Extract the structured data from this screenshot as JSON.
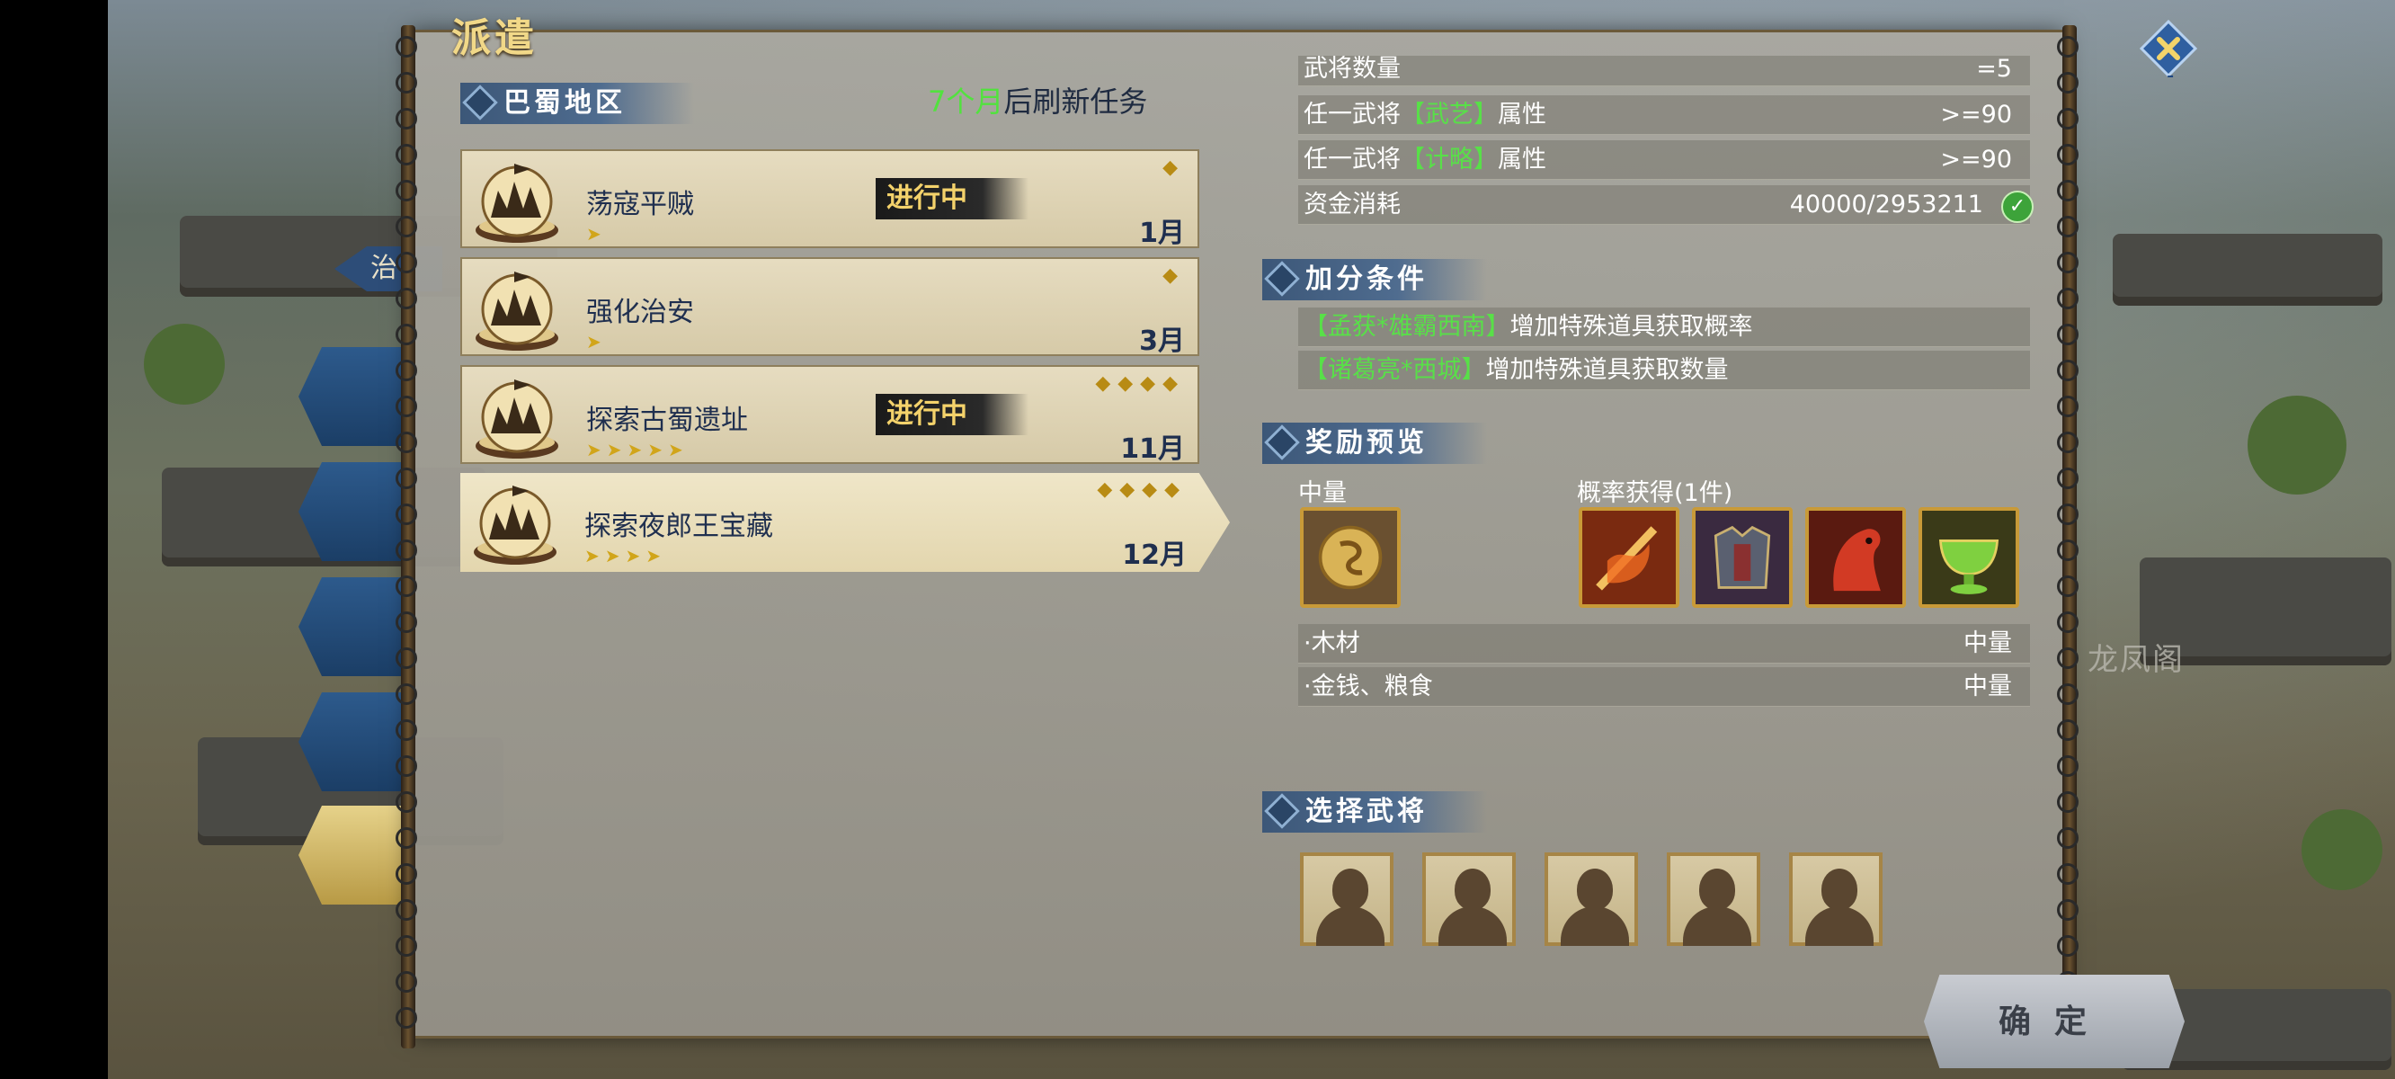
{
  "panel": {
    "title": "派遣"
  },
  "region": {
    "name": "巴蜀地区",
    "refresh_highlight": "7个月",
    "refresh_rest": "后刷新任务"
  },
  "missions": [
    {
      "name": "荡寇平贼",
      "month": "1月",
      "status": "进行中",
      "stars": 1,
      "difficulty": 1
    },
    {
      "name": "强化治安",
      "month": "3月",
      "status": "",
      "stars": 1,
      "difficulty": 1
    },
    {
      "name": "探索古蜀遗址",
      "month": "11月",
      "status": "进行中",
      "stars": 5,
      "difficulty": 4
    },
    {
      "name": "探索夜郎王宝藏",
      "month": "12月",
      "status": "",
      "stars": 4,
      "difficulty": 4
    }
  ],
  "requirements": {
    "row0": {
      "label": "武将数量",
      "value": "=5"
    },
    "row1": {
      "prefix": "任一武将",
      "highlight": "【武艺】",
      "suffix": "属性",
      "value": ">=90"
    },
    "row2": {
      "prefix": "任一武将",
      "highlight": "【计略】",
      "suffix": "属性",
      "value": ">=90"
    },
    "row3": {
      "label": "资金消耗",
      "value": "40000/2953211"
    }
  },
  "bonus": {
    "header": "加分条件",
    "items": [
      {
        "highlight": "【孟获*雄霸西南】",
        "text": "增加特殊道具获取概率"
      },
      {
        "highlight": "【诸葛亮*西城】",
        "text": "增加特殊道具获取数量"
      }
    ]
  },
  "rewards": {
    "header": "奖励预览",
    "fixed_label": "中量",
    "chance_label": "概率获得(1件)",
    "lines": [
      {
        "label": "·木材",
        "value": "中量"
      },
      {
        "label": "·金钱、粮食",
        "value": "中量"
      }
    ],
    "icons": [
      "coin-medal-icon",
      "flame-sword-icon",
      "armor-icon",
      "red-horse-icon",
      "jade-cup-icon"
    ]
  },
  "generals": {
    "header": "选择武将",
    "slots": 5
  },
  "buttons": {
    "confirm": "确定"
  },
  "sidebar": {
    "tag": "治"
  },
  "scene": {
    "city_label": "龙凤阁"
  },
  "colors": {
    "highlight_green": "#52e23e",
    "title_gold": "#f1d888",
    "header_blue": "#3c5778"
  }
}
